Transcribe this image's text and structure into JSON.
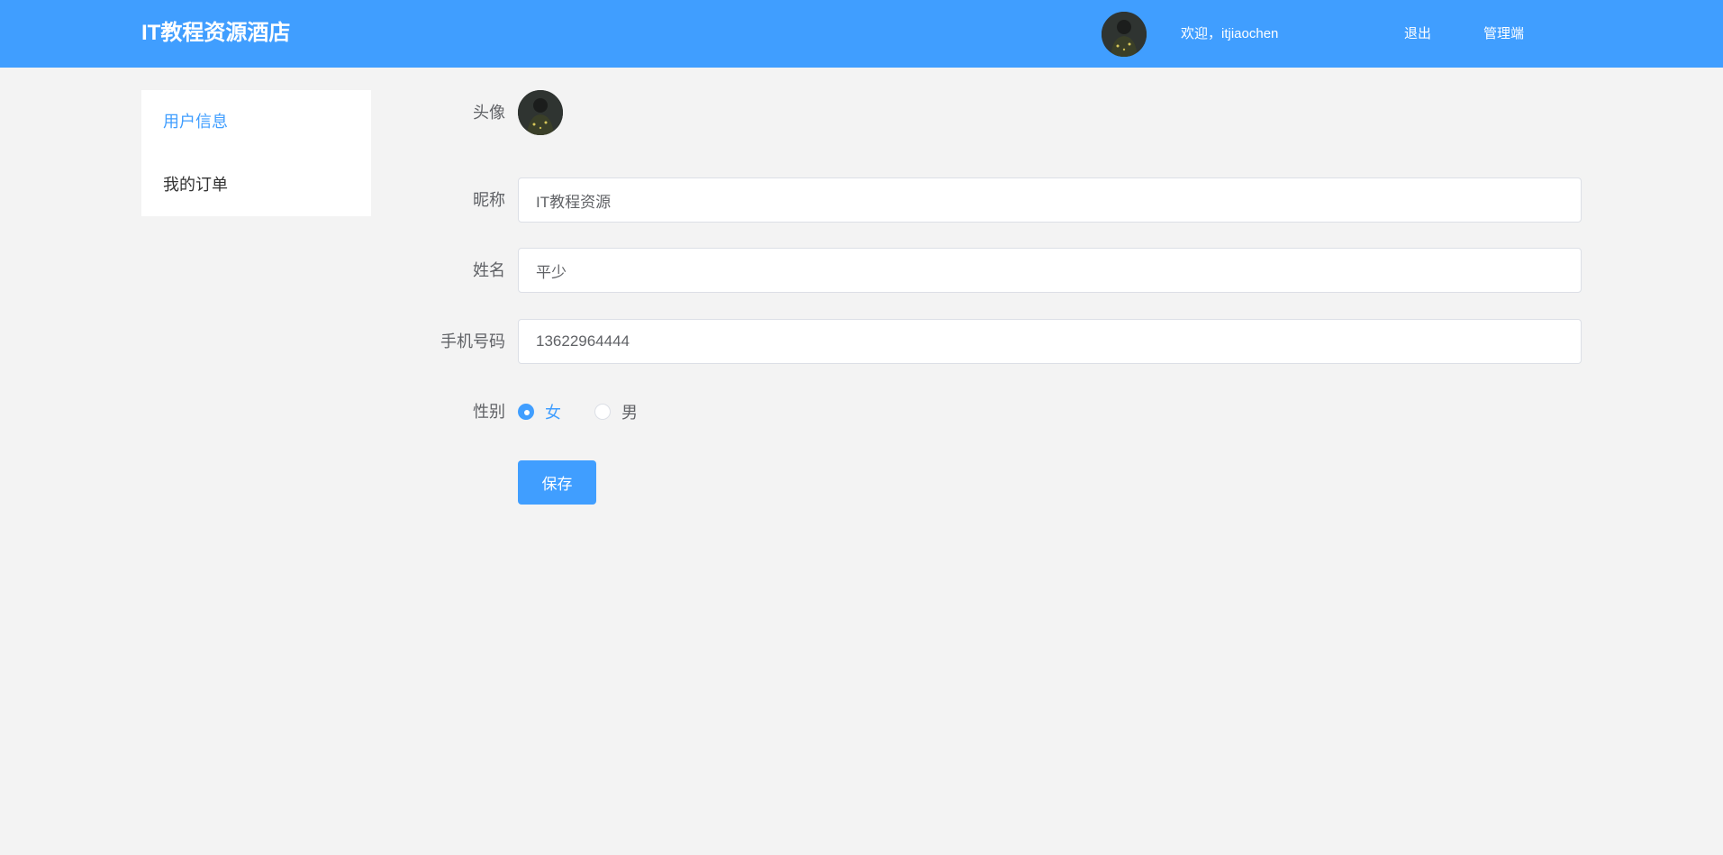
{
  "header": {
    "brand": "IT教程资源酒店",
    "welcome": "欢迎，itjiaochen",
    "logout": "退出",
    "admin": "管理端",
    "avatar_icon": "user-avatar-icon",
    "bg_color": "#409eff"
  },
  "sidebar": {
    "items": [
      {
        "label": "用户信息",
        "active": true
      },
      {
        "label": "我的订单",
        "active": false
      }
    ]
  },
  "form": {
    "avatar_label": "头像",
    "nickname_label": "昵称",
    "nickname_value": "IT教程资源",
    "name_label": "姓名",
    "name_value": "平少",
    "phone_label": "手机号码",
    "phone_value": "13622964444",
    "gender_label": "性别",
    "gender_options": [
      "女",
      "男"
    ],
    "gender_selected": "女",
    "save_label": "保存"
  },
  "colors": {
    "accent": "#409eff",
    "page_bg": "#f3f3f3"
  }
}
